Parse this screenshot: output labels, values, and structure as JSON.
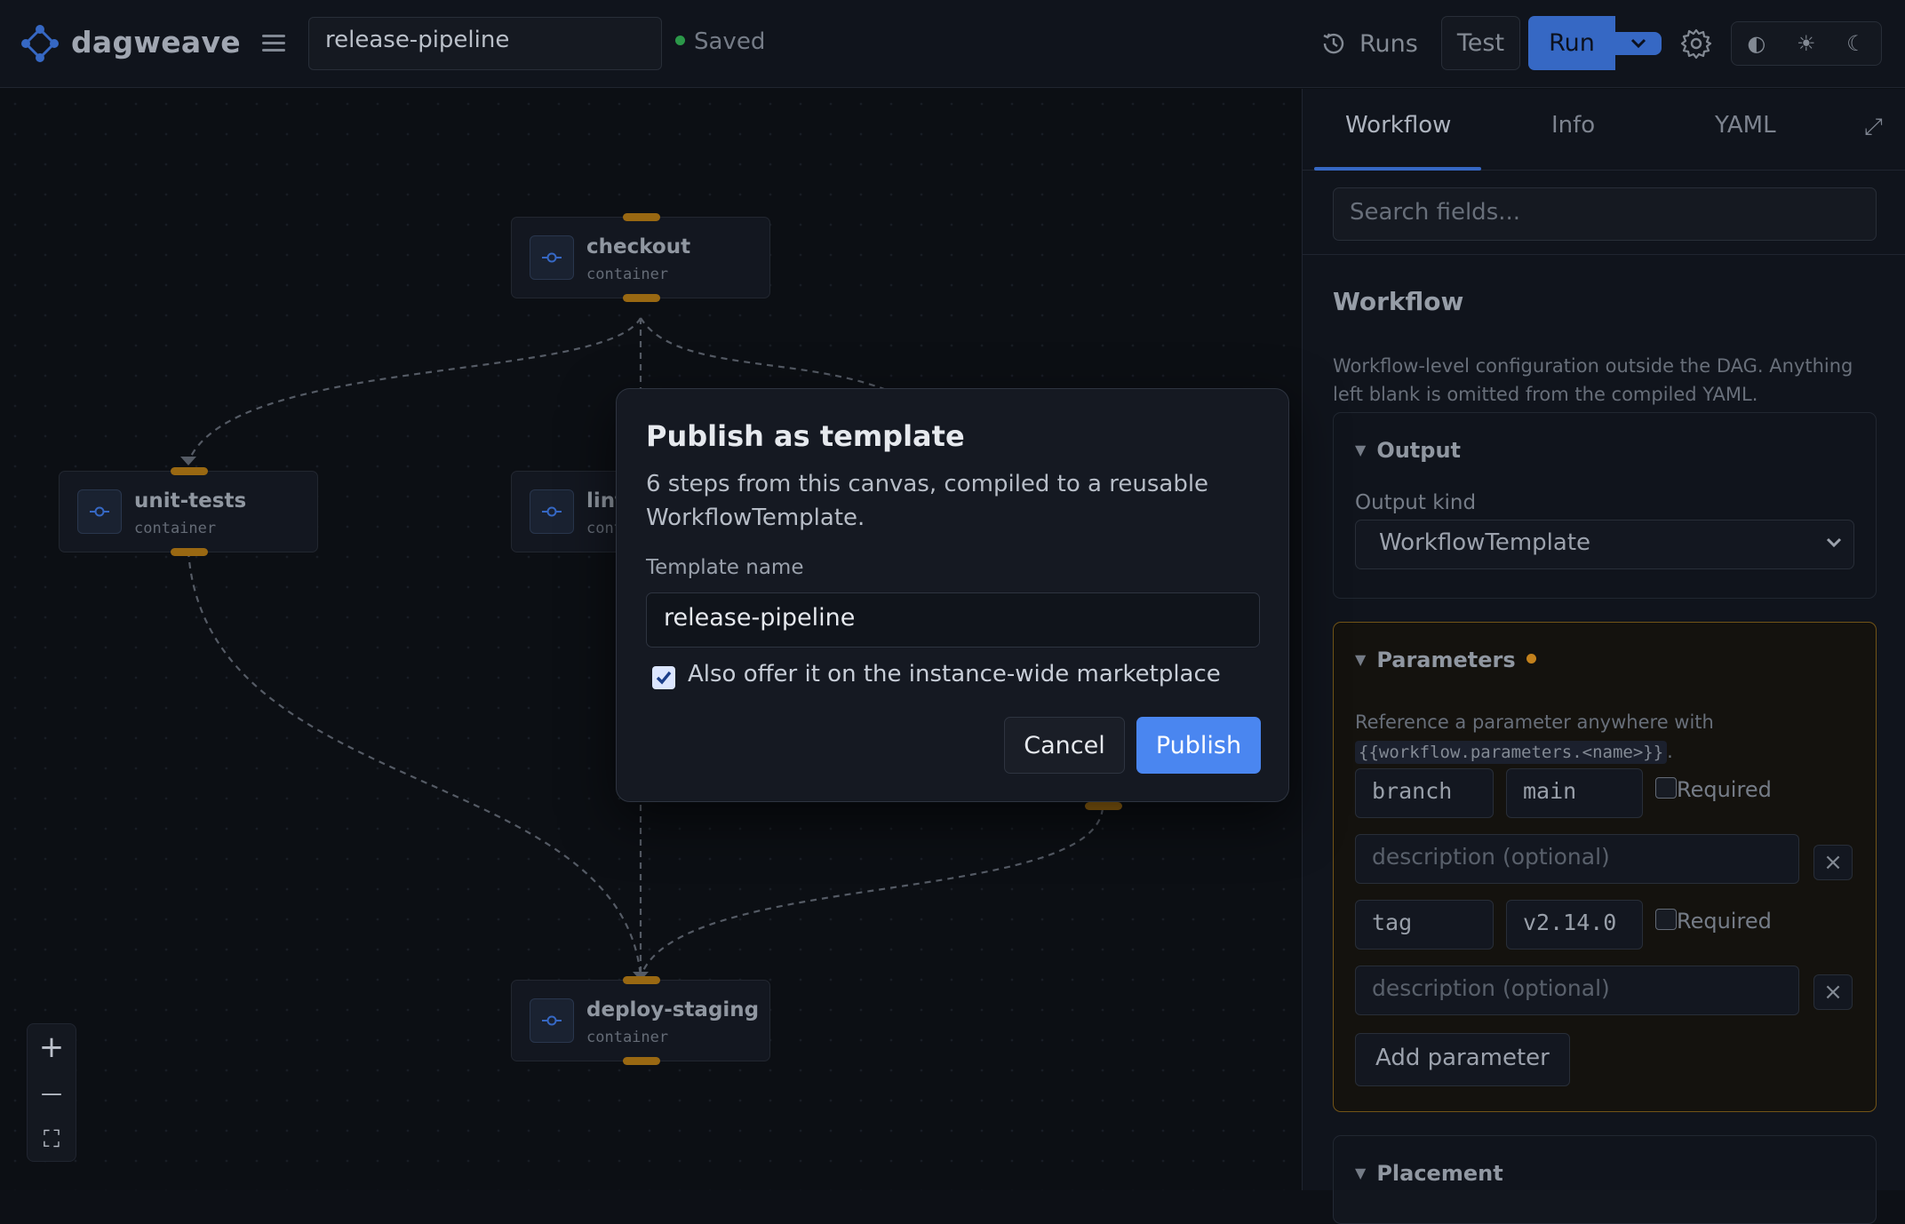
{
  "app": {
    "brand": "dagweave"
  },
  "header": {
    "workflow_name": "release-pipeline",
    "save_status": "Saved",
    "runs_label": "Runs",
    "test_label": "Test",
    "run_label": "Run",
    "theme_icons": [
      "◐",
      "☀",
      "☾"
    ]
  },
  "canvas": {
    "nodes": [
      {
        "title": "checkout",
        "type": "container"
      },
      {
        "title": "unit-tests",
        "type": "container"
      },
      {
        "title": "lint",
        "type": "container"
      },
      {
        "title": "deploy-staging",
        "type": "container"
      }
    ],
    "zoom_controls": [
      "+",
      "—",
      "⛶"
    ]
  },
  "panel": {
    "tabs": [
      "Workflow",
      "Info",
      "YAML"
    ],
    "active_tab": "Workflow",
    "search_placeholder": "Search fields...",
    "title": "Workflow",
    "description": "Workflow-level configuration outside the DAG. Anything left blank is omitted from the compiled YAML.",
    "output": {
      "heading": "Output",
      "kind_label": "Output kind",
      "kind_value": "WorkflowTemplate"
    },
    "parameters": {
      "heading": "Parameters",
      "hint_prefix": "Reference a parameter anywhere with",
      "hint_code": "{{workflow.parameters.<name>}}",
      "hint_suffix": ".",
      "items": [
        {
          "name": "branch",
          "value": "main",
          "required_label": "Required",
          "required": false,
          "description_placeholder": "description (optional)"
        },
        {
          "name": "tag",
          "value": "v2.14.0",
          "required_label": "Required",
          "required": false,
          "description_placeholder": "description (optional)"
        }
      ],
      "add_label": "Add parameter"
    },
    "placement": {
      "heading": "Placement"
    }
  },
  "modal": {
    "title": "Publish as template",
    "description": "6 steps from this canvas, compiled to a reusable WorkflowTemplate.",
    "name_label": "Template name",
    "name_value": "release-pipeline",
    "marketplace_label": "Also offer it on the instance-wide marketplace",
    "marketplace_checked": true,
    "cancel_label": "Cancel",
    "publish_label": "Publish"
  },
  "colors": {
    "accent": "#4a86f0",
    "run_button": "#3a6fd1",
    "handle": "#a36f14",
    "saved_dot": "#2ea24e",
    "params_border": "#7a5a19"
  }
}
